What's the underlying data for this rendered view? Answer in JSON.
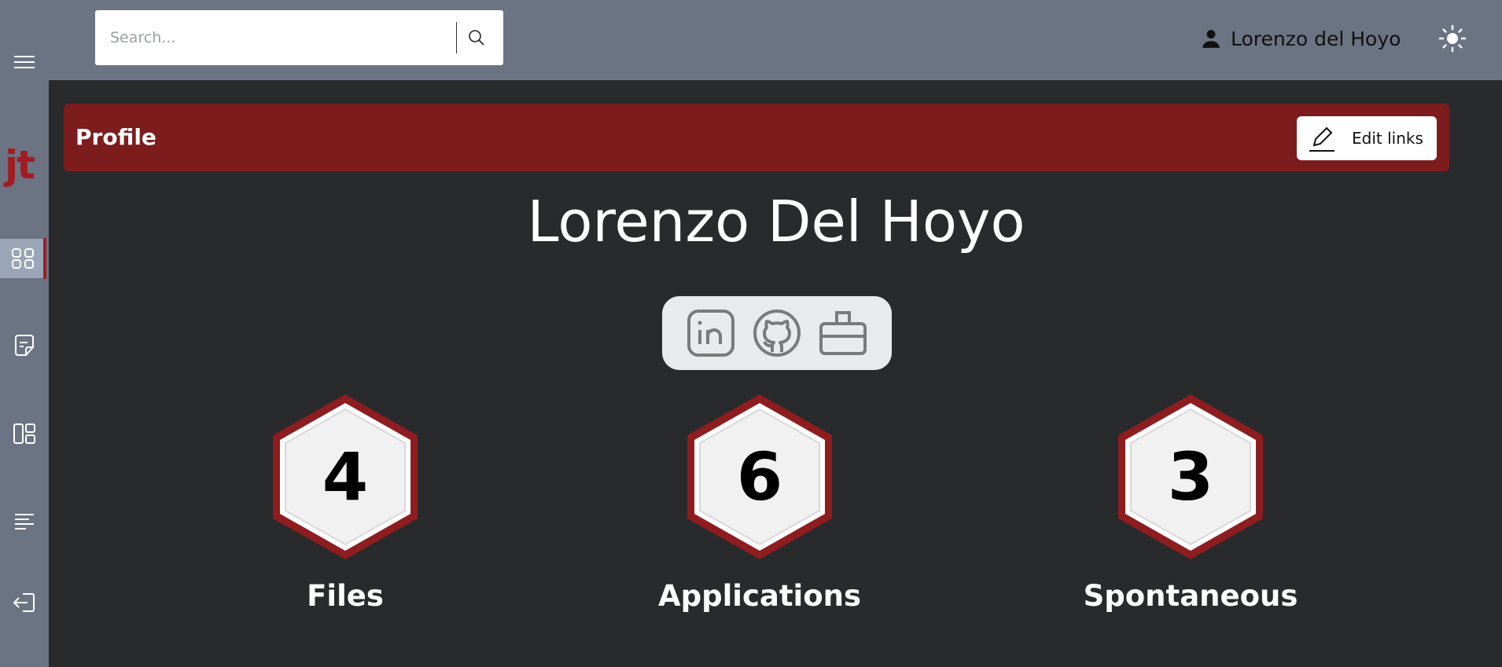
{
  "sidebar": {
    "logo": "jt",
    "items": [
      {
        "icon": "menu-icon"
      },
      {
        "icon": "dashboard-icon",
        "active": true
      },
      {
        "icon": "file-icon"
      },
      {
        "icon": "layout-icon"
      },
      {
        "icon": "list-icon"
      },
      {
        "icon": "logout-icon"
      }
    ]
  },
  "header": {
    "search_placeholder": "Search...",
    "user_name": "Lorenzo del Hoyo"
  },
  "profile": {
    "title": "Profile",
    "edit_label": "Edit links",
    "name": "Lorenzo Del Hoyo",
    "links": [
      "linkedin-icon",
      "github-icon",
      "briefcase-icon"
    ]
  },
  "stats": [
    {
      "value": "4",
      "label": "Files"
    },
    {
      "value": "6",
      "label": "Applications"
    },
    {
      "value": "3",
      "label": "Spontaneous"
    }
  ],
  "colors": {
    "accent": "#7d1c1d",
    "sidebar": "#6c7483",
    "background": "#282a2c"
  }
}
